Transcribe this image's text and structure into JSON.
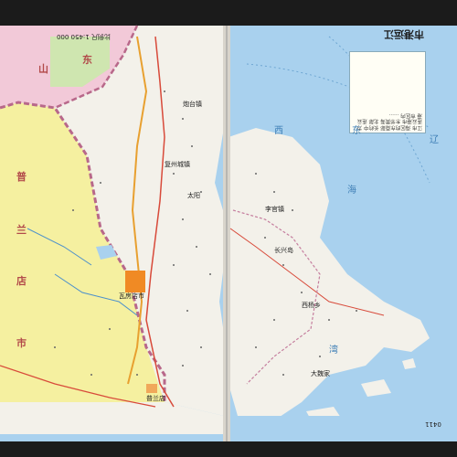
{
  "map": {
    "title": "市港运江",
    "scale_text": "比例尺 1:450 000",
    "page_number": "0411",
    "side_label": "市",
    "note_text": "江市 海区的东南部 长约中 为连云港市 东邻黄海 北部 连云港 市区内 ……",
    "place_labels": [
      {
        "id": "top-left-province",
        "text": "山"
      },
      {
        "id": "top-left-province-2",
        "text": "东"
      },
      {
        "id": "left-province-1",
        "text": "普"
      },
      {
        "id": "left-province-2",
        "text": "兰"
      },
      {
        "id": "left-province-3",
        "text": "店"
      },
      {
        "id": "left-province-4",
        "text": "市"
      },
      {
        "id": "sea-label-1",
        "text": "西"
      },
      {
        "id": "sea-label-2",
        "text": "东"
      },
      {
        "id": "sea-label-3",
        "text": "辽"
      },
      {
        "id": "sea-label-4",
        "text": "海"
      },
      {
        "id": "bay-label",
        "text": "湾"
      },
      {
        "id": "city-label",
        "text": "瓦房店市"
      },
      {
        "id": "town-1",
        "text": "复州城镇"
      },
      {
        "id": "town-2",
        "text": "太阳"
      },
      {
        "id": "town-3",
        "text": "李官镇"
      },
      {
        "id": "town-4",
        "text": "长兴岛"
      },
      {
        "id": "town-5",
        "text": "炮台镇"
      },
      {
        "id": "town-6",
        "text": "西杨乡"
      },
      {
        "id": "town-7",
        "text": "大魏家"
      },
      {
        "id": "town-8",
        "text": "普兰店"
      }
    ],
    "colors": {
      "sea": "#a9d1ee",
      "land_main": "#f3f1ea",
      "land_yellow": "#f5f0a0",
      "land_pink": "#f2c9d8",
      "land_green": "#cfe6b0",
      "border": "#b8688a",
      "road": "#d84a3a",
      "river": "#4a8fcc",
      "city": "#f08a24"
    }
  }
}
